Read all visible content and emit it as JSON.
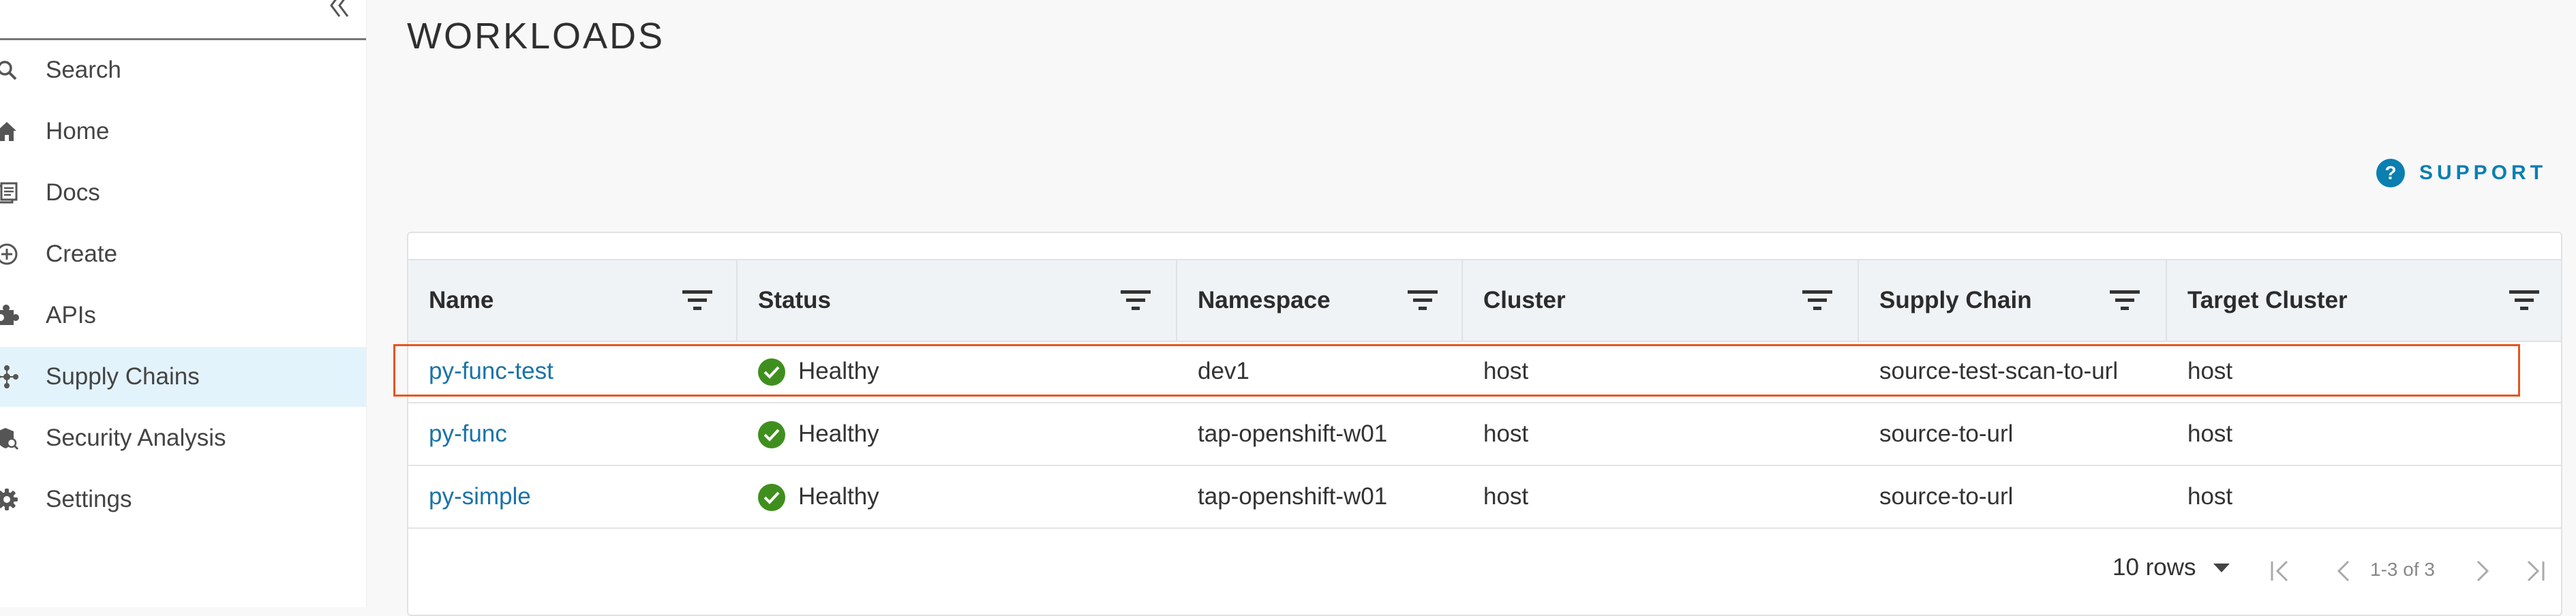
{
  "sidebar": {
    "collapse_label": "«",
    "items": [
      {
        "label": "Search",
        "icon": "search-icon"
      },
      {
        "label": "Home",
        "icon": "home-icon"
      },
      {
        "label": "Docs",
        "icon": "docs-icon"
      },
      {
        "label": "Create",
        "icon": "plus-circle-icon"
      },
      {
        "label": "APIs",
        "icon": "puzzle-icon"
      },
      {
        "label": "Supply Chains",
        "icon": "supply-chain-icon",
        "active": true
      },
      {
        "label": "Security Analysis",
        "icon": "shield-search-icon"
      },
      {
        "label": "Settings",
        "icon": "gear-icon"
      }
    ]
  },
  "header": {
    "title": "WORKLOADS",
    "support_label": "SUPPORT"
  },
  "table": {
    "columns": [
      "Name",
      "Status",
      "Namespace",
      "Cluster",
      "Supply Chain",
      "Target Cluster"
    ],
    "rows": [
      {
        "name": "py-func-test",
        "status": "Healthy",
        "namespace": "dev1",
        "cluster": "host",
        "supply_chain": "source-test-scan-to-url",
        "target_cluster": "host",
        "highlighted": true
      },
      {
        "name": "py-func",
        "status": "Healthy",
        "namespace": "tap-openshift-w01",
        "cluster": "host",
        "supply_chain": "source-to-url",
        "target_cluster": "host"
      },
      {
        "name": "py-simple",
        "status": "Healthy",
        "namespace": "tap-openshift-w01",
        "cluster": "host",
        "supply_chain": "source-to-url",
        "target_cluster": "host"
      }
    ]
  },
  "pagination": {
    "rows_per_page": "10 rows",
    "range": "1-3 of 3"
  },
  "colors": {
    "accent": "#0a7fb0",
    "link": "#1a73a8",
    "healthy": "#3f8f1e",
    "highlight": "#e8551f",
    "active_nav": "#e3f3fc"
  }
}
